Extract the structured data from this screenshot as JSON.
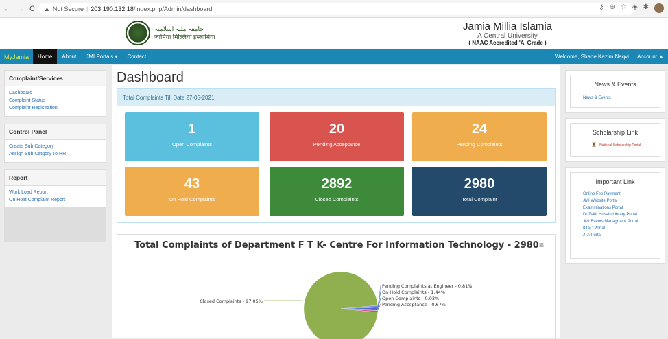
{
  "browser": {
    "back": "←",
    "forward": "→",
    "reload": "C",
    "security": "Not Secure",
    "url_host": "203.190.132.18",
    "url_path": "/index.php/Admin/dashboard"
  },
  "header": {
    "logo_text_urdu": "جامعہ ملیہ اسلامیہ",
    "logo_text_hindi": "जामिया मिल्लिया इस्लामिया",
    "university_name": "Jamia Millia Islamia",
    "university_sub": "A Central University",
    "grade": "( NAAC Accredited 'A' Grade )"
  },
  "navbar": {
    "brand": "MyJamia",
    "items": [
      {
        "label": "Home"
      },
      {
        "label": "About"
      },
      {
        "label": "JMI Portals ▾"
      },
      {
        "label": "Contact"
      }
    ],
    "welcome": "Welcome, Shane Kazim Naqvi",
    "account": "Account ▲"
  },
  "sidebar": {
    "sections": [
      {
        "title": "Complaint/Services",
        "links": [
          "Dashboard",
          "Complaint Status",
          "Complaint Registration"
        ]
      },
      {
        "title": "Control Panel",
        "links": [
          "Create Sub Category",
          "Assign Sub Catgory To HR"
        ]
      },
      {
        "title": "Report",
        "links": [
          "Work Load Report",
          "On Hold Complaint Report"
        ]
      }
    ]
  },
  "main": {
    "title": "Dashboard",
    "total_bar": "Total Complaints Till Date 27-05-2021",
    "cards": [
      {
        "value": "1",
        "label": "Open Complaints",
        "color": "#5bc0de"
      },
      {
        "value": "20",
        "label": "Pending Acceptance",
        "color": "#d9534f"
      },
      {
        "value": "24",
        "label": "Pending Complaints",
        "color": "#f0ad4e"
      },
      {
        "value": "43",
        "label": "On Hold Complaints",
        "color": "#f0ad4e"
      },
      {
        "value": "2892",
        "label": "Closed Complaints",
        "color": "#3c8a3a"
      },
      {
        "value": "2980",
        "label": "Total Complaint",
        "color": "#23496b"
      }
    ],
    "chart_menu_icon": "≡"
  },
  "chart_data": {
    "type": "pie",
    "title": "Total Complaints of Department F T K- Centre For Information Technology - 2980",
    "slices": [
      {
        "name": "Closed Complaints",
        "value": 97.05,
        "label": "Closed Complaints - 97.05%",
        "color": "#90b050"
      },
      {
        "name": "Pending Complaints at Engineer",
        "value": 0.81,
        "label": "Pending Complaints at Engineer - 0.81%",
        "color": "#8085e9"
      },
      {
        "name": "On Hold Complaints",
        "value": 1.44,
        "label": "On Hold Complaints - 1.44%",
        "color": "#4a6fd0"
      },
      {
        "name": "Open Complaints",
        "value": 0.03,
        "label": "Open Complaints - 0.03%",
        "color": "#2b908f"
      },
      {
        "name": "Pending Acceptance",
        "value": 0.67,
        "label": "Pending Acceptance - 0.67%",
        "color": "#d04a8a"
      }
    ]
  },
  "right": {
    "news_title": "News & Events",
    "news_items": [
      "News & Events"
    ],
    "scholarship_title": "Scholarship Link",
    "scholarship_caption": "National Scholarship Portal",
    "important_title": "Important Link",
    "important_links": [
      "Online Fee Payment",
      "JMI Website Portal",
      "Examminations Portal",
      "Dr Zakir Husain Library Portal",
      "JMI Events Managment Portal",
      "IQAC Portal",
      "JTA Portal"
    ]
  }
}
